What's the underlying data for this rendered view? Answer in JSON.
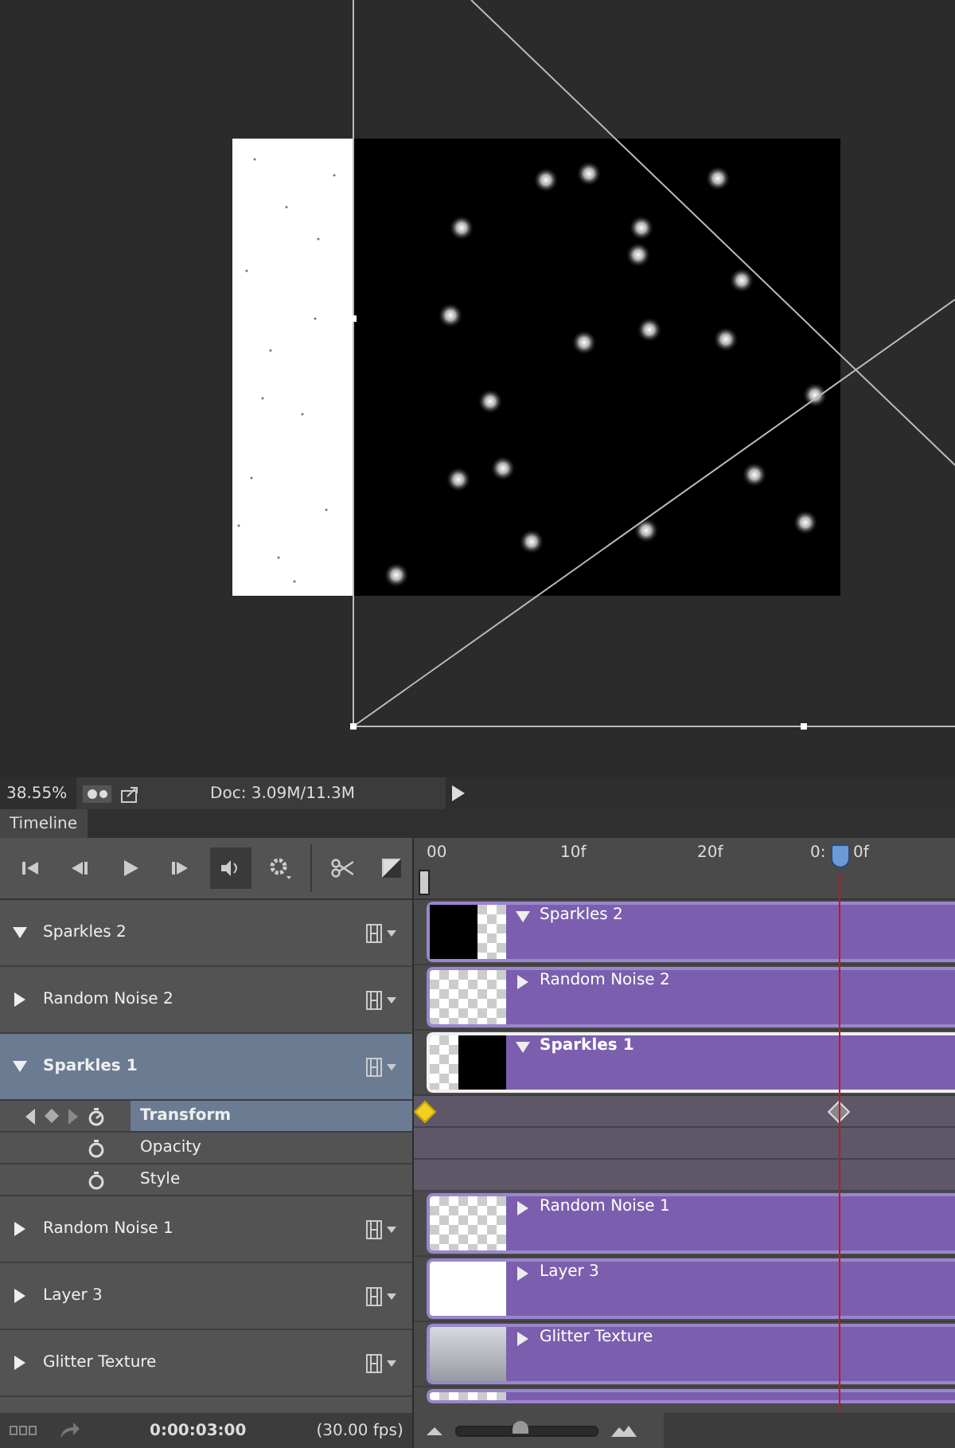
{
  "status_bar": {
    "zoom": "38.55%",
    "doc": "Doc: 3.09M/11.3M"
  },
  "panel_tab": {
    "label": "Timeline",
    "selected": true
  },
  "controls": {
    "audio_on": true
  },
  "ruler": {
    "labels": [
      "00",
      "10f",
      "20f",
      "0:",
      "0f"
    ]
  },
  "layers": [
    {
      "name": "Sparkles 2",
      "clip_label": "Sparkles 2",
      "expanded": true,
      "selected": false,
      "thumbnail": {
        "kind": "sparkles-right"
      }
    },
    {
      "name": "Random Noise 2",
      "clip_label": "Random Noise 2",
      "expanded": false,
      "selected": false,
      "thumbnail": {
        "kind": "transparent"
      }
    },
    {
      "name": "Sparkles 1",
      "clip_label": "Sparkles 1",
      "expanded": true,
      "selected": true,
      "thumbnail": {
        "kind": "sparkles-left"
      },
      "properties": [
        {
          "name": "Transform",
          "selected": true,
          "animated": true,
          "keyframes": [
            {
              "kind": "start",
              "selected": true
            },
            {
              "kind": "playhead",
              "selected": false
            }
          ]
        },
        {
          "name": "Opacity",
          "selected": false,
          "animated": false
        },
        {
          "name": "Style",
          "selected": false,
          "animated": false
        }
      ]
    },
    {
      "name": "Random Noise 1",
      "clip_label": "Random Noise 1",
      "expanded": false,
      "selected": false,
      "thumbnail": {
        "kind": "transparent"
      }
    },
    {
      "name": "Layer 3",
      "clip_label": "Layer 3",
      "expanded": false,
      "selected": false,
      "thumbnail": {
        "kind": "white"
      }
    },
    {
      "name": "Glitter Texture",
      "clip_label": "Glitter Texture",
      "expanded": false,
      "selected": false,
      "thumbnail": {
        "kind": "texture"
      }
    }
  ],
  "partial_layer": {
    "thumbnail": {
      "kind": "transparent"
    }
  },
  "footer": {
    "time": "0:00:03:00",
    "fps": "(30.00 fps)",
    "zoom": {
      "level": 0.45
    }
  }
}
